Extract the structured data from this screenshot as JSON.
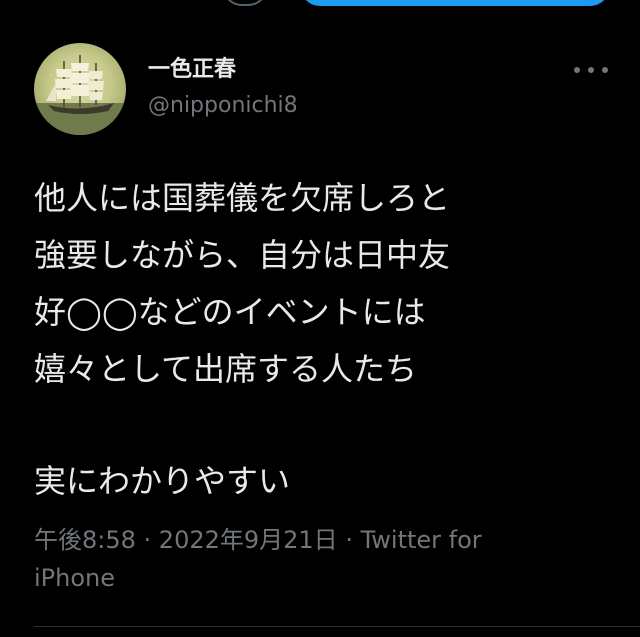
{
  "tweet": {
    "author": {
      "display_name": "一色正春",
      "handle": "@nipponichi8",
      "avatar": "sailing-ship-avatar"
    },
    "text_lines": [
      "他人には国葬儀を欠席しろと",
      "強要しながら、自分は日中友",
      "好◯◯などのイベントには",
      "嬉々として出席する人たち",
      "",
      "実にわかりやすい"
    ],
    "time": "午後8:58",
    "separator": " · ",
    "date": "2022年9月21日",
    "source_line1": "Twitter for",
    "source_line2": "iPhone"
  },
  "icons": {
    "more": "more-dots-icon"
  },
  "colors": {
    "background": "#000000",
    "text_primary": "#e7e9ea",
    "text_secondary": "#71767b",
    "accent": "#1d9bf0",
    "divider": "#2f3336"
  }
}
